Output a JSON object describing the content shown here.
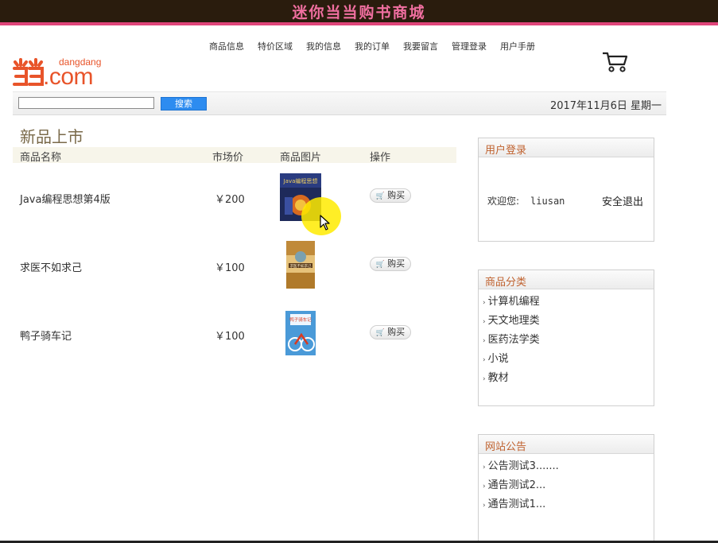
{
  "header": {
    "title": "迷你当当购书商城"
  },
  "logo": {
    "small_text": "dangdang",
    "big_text": ".com",
    "icon": "dangdang-logo-icon"
  },
  "nav": {
    "items": [
      "商品信息",
      "特价区域",
      "我的信息",
      "我的订单",
      "我要留言",
      "管理登录",
      "用户手册"
    ]
  },
  "cart": {
    "icon": "shopping-cart-icon"
  },
  "search": {
    "input_value": "",
    "button_label": "搜索"
  },
  "date": "2017年11月6日 星期一",
  "main": {
    "section_title": "新品上市",
    "columns": [
      "商品名称",
      "市场价",
      "商品图片",
      "操作"
    ],
    "rows": [
      {
        "name": "Java编程思想第4版",
        "price": "￥200",
        "image_title": "Java编程思想",
        "buy_label": "购买"
      },
      {
        "name": "求医不如求己",
        "price": "￥100",
        "image_title": "求医不如求己",
        "buy_label": "购买"
      },
      {
        "name": "鸭子骑车记",
        "price": "￥100",
        "image_title": "鸭子骑车记",
        "buy_label": "购买"
      }
    ]
  },
  "sidebar": {
    "login": {
      "title": "用户登录",
      "welcome_label": "欢迎您:",
      "username": "liusan",
      "logout_label": "安全退出"
    },
    "categories": {
      "title": "商品分类",
      "items": [
        "计算机编程",
        "天文地理类",
        "医药法学类",
        "小说",
        "教材"
      ]
    },
    "notices": {
      "title": "网站公告",
      "items": [
        "公告测试3.......",
        "通告测试2...",
        "通告测试1..."
      ]
    }
  },
  "colors": {
    "header_bg": "#2a1c0d",
    "header_text": "#f06fa0",
    "accent_bar": "#e0457a",
    "brand": "#e8542a",
    "search_button": "#2d8cf0",
    "panel_title": "#c0622f"
  }
}
